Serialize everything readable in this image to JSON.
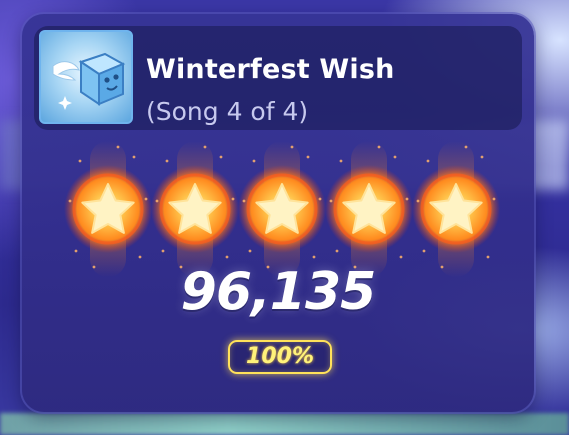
{
  "song": {
    "title": "Winterfest Wish",
    "subtitle": "(Song 4 of 4)",
    "album_art_icon": "winged-ice-cube-icon"
  },
  "result": {
    "stars_earned": 5,
    "stars_total": 5,
    "score": "96,135",
    "percentage": "100%"
  },
  "colors": {
    "star_glow": "#ff8a1e",
    "star_fill": "#fff3c4",
    "percent_badge": "#ffe25a",
    "panel": "#36349a"
  }
}
